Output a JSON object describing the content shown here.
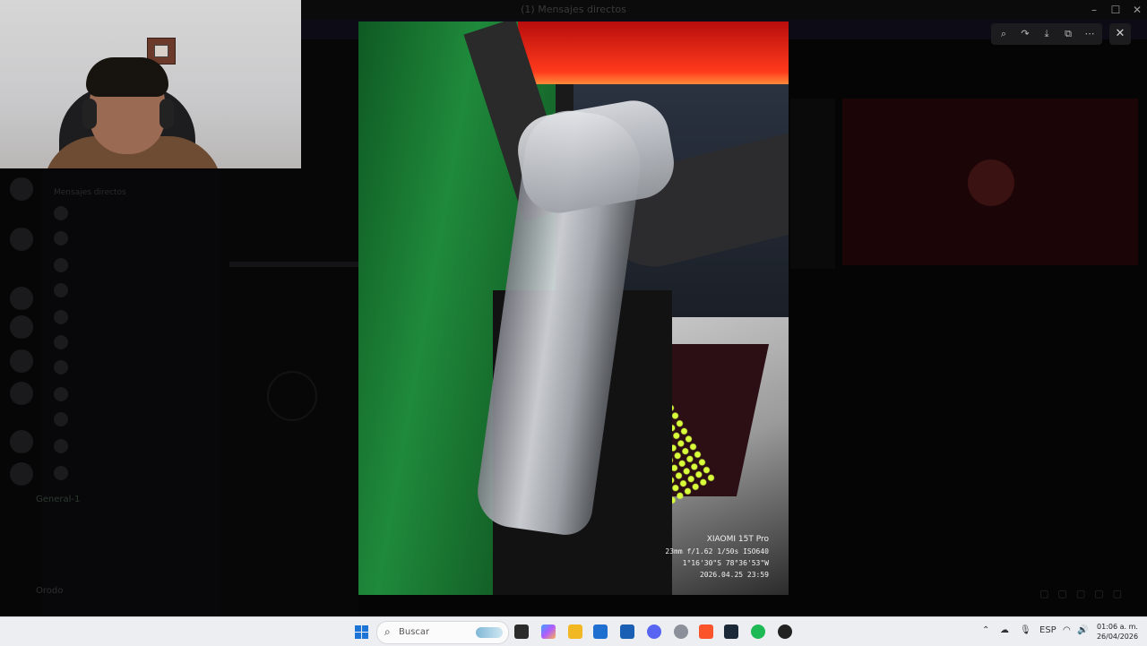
{
  "background_app": {
    "window_title": "(1) Mensajes directos",
    "section_label": "Mensajes directos",
    "dm_list": [
      "",
      "",
      "",
      "",
      "",
      "",
      "",
      "",
      "",
      "",
      ""
    ],
    "voice_channel": "General-1",
    "voice_status": "",
    "user_name": "Orodo"
  },
  "photo": {
    "camera_brand": "XIAOMI 15T Pro",
    "exif_line": "23mm f/1.62 1/50s ISO640",
    "gps_line": "1°16'30\"S 78°36'53\"W",
    "datetime_line": "2026.04.25 23:59"
  },
  "viewer_toolbar": {
    "zoom_icon": "zoom-in-icon",
    "forward_icon": "forward-icon",
    "download_icon": "download-icon",
    "open_icon": "open-external-icon",
    "more_icon": "more-icon",
    "close_icon": "close-icon"
  },
  "taskbar": {
    "search_placeholder": "Buscar",
    "language": "ESP",
    "time": "01:06 a. m.",
    "date": "26/04/2026"
  },
  "colors": {
    "taskbar_bg": "#eceef2",
    "windows_blue": "#1b74d6",
    "accent_red": "#ff3a1c"
  }
}
